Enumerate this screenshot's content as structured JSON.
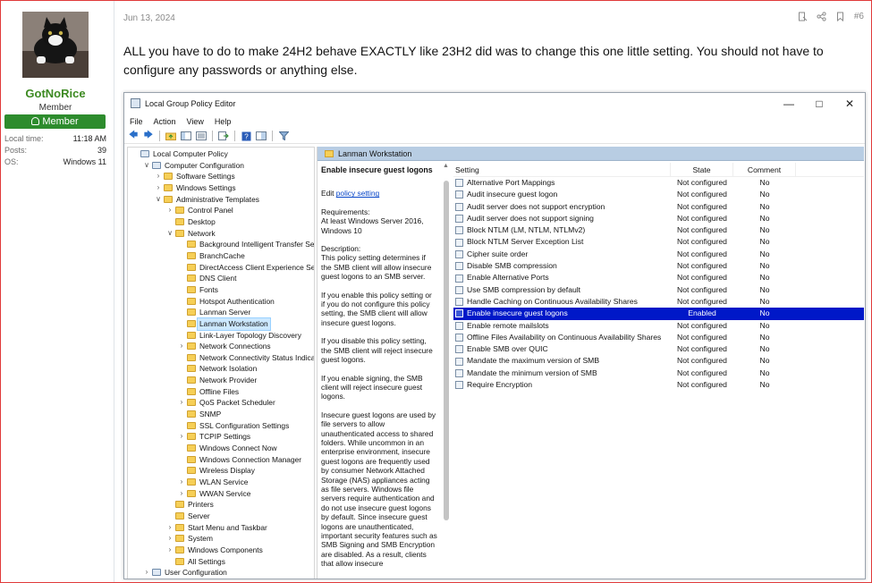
{
  "user": {
    "name": "GotNoRice",
    "title": "Member",
    "banner": "Member",
    "stats": [
      {
        "key": "Local time:",
        "value": "11:18 AM"
      },
      {
        "key": "Posts:",
        "value": "39"
      },
      {
        "key": "OS:",
        "value": "Windows 11"
      }
    ]
  },
  "post": {
    "date": "Jun 13, 2024",
    "number": "#6",
    "text": "ALL you have to do to make 24H2 behave EXACTLY like 23H2 did was to change this one little setting. You should not have to configure any passwords or anything else."
  },
  "window": {
    "title": "Local Group Policy Editor",
    "menu": [
      "File",
      "Action",
      "View",
      "Help"
    ],
    "tree": [
      {
        "label": "Local Computer Policy",
        "depth": 0,
        "exp": "",
        "folder": false
      },
      {
        "label": "Computer Configuration",
        "depth": 1,
        "exp": "v",
        "folder": false
      },
      {
        "label": "Software Settings",
        "depth": 2,
        "exp": ">",
        "folder": true
      },
      {
        "label": "Windows Settings",
        "depth": 2,
        "exp": ">",
        "folder": true
      },
      {
        "label": "Administrative Templates",
        "depth": 2,
        "exp": "v",
        "folder": true
      },
      {
        "label": "Control Panel",
        "depth": 3,
        "exp": ">",
        "folder": true
      },
      {
        "label": "Desktop",
        "depth": 3,
        "exp": "",
        "folder": true
      },
      {
        "label": "Network",
        "depth": 3,
        "exp": "v",
        "folder": true
      },
      {
        "label": "Background Intelligent Transfer Servic",
        "depth": 4,
        "exp": "",
        "folder": true
      },
      {
        "label": "BranchCache",
        "depth": 4,
        "exp": "",
        "folder": true
      },
      {
        "label": "DirectAccess Client Experience Setting",
        "depth": 4,
        "exp": "",
        "folder": true
      },
      {
        "label": "DNS Client",
        "depth": 4,
        "exp": "",
        "folder": true
      },
      {
        "label": "Fonts",
        "depth": 4,
        "exp": "",
        "folder": true
      },
      {
        "label": "Hotspot Authentication",
        "depth": 4,
        "exp": "",
        "folder": true
      },
      {
        "label": "Lanman Server",
        "depth": 4,
        "exp": "",
        "folder": true
      },
      {
        "label": "Lanman Workstation",
        "depth": 4,
        "exp": "",
        "folder": true,
        "selected": true
      },
      {
        "label": "Link-Layer Topology Discovery",
        "depth": 4,
        "exp": "",
        "folder": true
      },
      {
        "label": "Network Connections",
        "depth": 4,
        "exp": ">",
        "folder": true
      },
      {
        "label": "Network Connectivity Status Indicator",
        "depth": 4,
        "exp": "",
        "folder": true
      },
      {
        "label": "Network Isolation",
        "depth": 4,
        "exp": "",
        "folder": true
      },
      {
        "label": "Network Provider",
        "depth": 4,
        "exp": "",
        "folder": true
      },
      {
        "label": "Offline Files",
        "depth": 4,
        "exp": "",
        "folder": true
      },
      {
        "label": "QoS Packet Scheduler",
        "depth": 4,
        "exp": ">",
        "folder": true
      },
      {
        "label": "SNMP",
        "depth": 4,
        "exp": "",
        "folder": true
      },
      {
        "label": "SSL Configuration Settings",
        "depth": 4,
        "exp": "",
        "folder": true
      },
      {
        "label": "TCPIP Settings",
        "depth": 4,
        "exp": ">",
        "folder": true
      },
      {
        "label": "Windows Connect Now",
        "depth": 4,
        "exp": "",
        "folder": true
      },
      {
        "label": "Windows Connection Manager",
        "depth": 4,
        "exp": "",
        "folder": true
      },
      {
        "label": "Wireless Display",
        "depth": 4,
        "exp": "",
        "folder": true
      },
      {
        "label": "WLAN Service",
        "depth": 4,
        "exp": ">",
        "folder": true
      },
      {
        "label": "WWAN Service",
        "depth": 4,
        "exp": ">",
        "folder": true
      },
      {
        "label": "Printers",
        "depth": 3,
        "exp": "",
        "folder": true
      },
      {
        "label": "Server",
        "depth": 3,
        "exp": "",
        "folder": true
      },
      {
        "label": "Start Menu and Taskbar",
        "depth": 3,
        "exp": ">",
        "folder": true
      },
      {
        "label": "System",
        "depth": 3,
        "exp": ">",
        "folder": true
      },
      {
        "label": "Windows Components",
        "depth": 3,
        "exp": ">",
        "folder": true
      },
      {
        "label": "All Settings",
        "depth": 3,
        "exp": "",
        "folder": true
      },
      {
        "label": "User Configuration",
        "depth": 1,
        "exp": ">",
        "folder": false
      }
    ],
    "right_header": "Lanman Workstation",
    "description": {
      "title": "Enable insecure guest logons",
      "edit_prefix": "Edit ",
      "edit_link": "policy setting",
      "paragraphs": [
        "Requirements:\nAt least Windows Server 2016, Windows 10",
        "Description:\nThis policy setting determines if the SMB client will allow insecure guest logons to an SMB server.",
        "If you enable this policy setting or if you do not configure this policy setting, the SMB client will allow insecure guest logons.",
        "If you disable this policy setting, the SMB client will reject insecure guest logons.",
        "If you enable signing, the SMB client will reject insecure guest logons.",
        "Insecure guest logons are used by file servers to allow unauthenticated access to shared folders. While uncommon in an enterprise environment, insecure guest logons are frequently used by consumer Network Attached Storage (NAS) appliances acting as file servers. Windows file servers require authentication and do not use insecure guest logons by default. Since insecure guest logons are unauthenticated, important security features such as SMB Signing and SMB Encryption are disabled. As a result, clients that allow insecure"
      ]
    },
    "columns": {
      "setting": "Setting",
      "state": "State",
      "comment": "Comment"
    },
    "settings": [
      {
        "name": "Alternative Port Mappings",
        "state": "Not configured",
        "comment": "No"
      },
      {
        "name": "Audit insecure guest logon",
        "state": "Not configured",
        "comment": "No"
      },
      {
        "name": "Audit server does not support encryption",
        "state": "Not configured",
        "comment": "No"
      },
      {
        "name": "Audit server does not support signing",
        "state": "Not configured",
        "comment": "No"
      },
      {
        "name": "Block NTLM (LM, NTLM, NTLMv2)",
        "state": "Not configured",
        "comment": "No"
      },
      {
        "name": "Block NTLM Server Exception List",
        "state": "Not configured",
        "comment": "No"
      },
      {
        "name": "Cipher suite order",
        "state": "Not configured",
        "comment": "No"
      },
      {
        "name": "Disable SMB compression",
        "state": "Not configured",
        "comment": "No"
      },
      {
        "name": "Enable Alternative Ports",
        "state": "Not configured",
        "comment": "No"
      },
      {
        "name": "Use SMB compression by default",
        "state": "Not configured",
        "comment": "No"
      },
      {
        "name": "Handle Caching on Continuous Availability Shares",
        "state": "Not configured",
        "comment": "No"
      },
      {
        "name": "Enable insecure guest logons",
        "state": "Enabled",
        "comment": "No",
        "highlighted": true
      },
      {
        "name": "Enable remote mailslots",
        "state": "Not configured",
        "comment": "No"
      },
      {
        "name": "Offline Files Availability on Continuous Availability Shares",
        "state": "Not configured",
        "comment": "No"
      },
      {
        "name": "Enable SMB over QUIC",
        "state": "Not configured",
        "comment": "No"
      },
      {
        "name": "Mandate the maximum version of SMB",
        "state": "Not configured",
        "comment": "No"
      },
      {
        "name": "Mandate the minimum version of SMB",
        "state": "Not configured",
        "comment": "No"
      },
      {
        "name": "Require Encryption",
        "state": "Not configured",
        "comment": "No"
      }
    ]
  }
}
